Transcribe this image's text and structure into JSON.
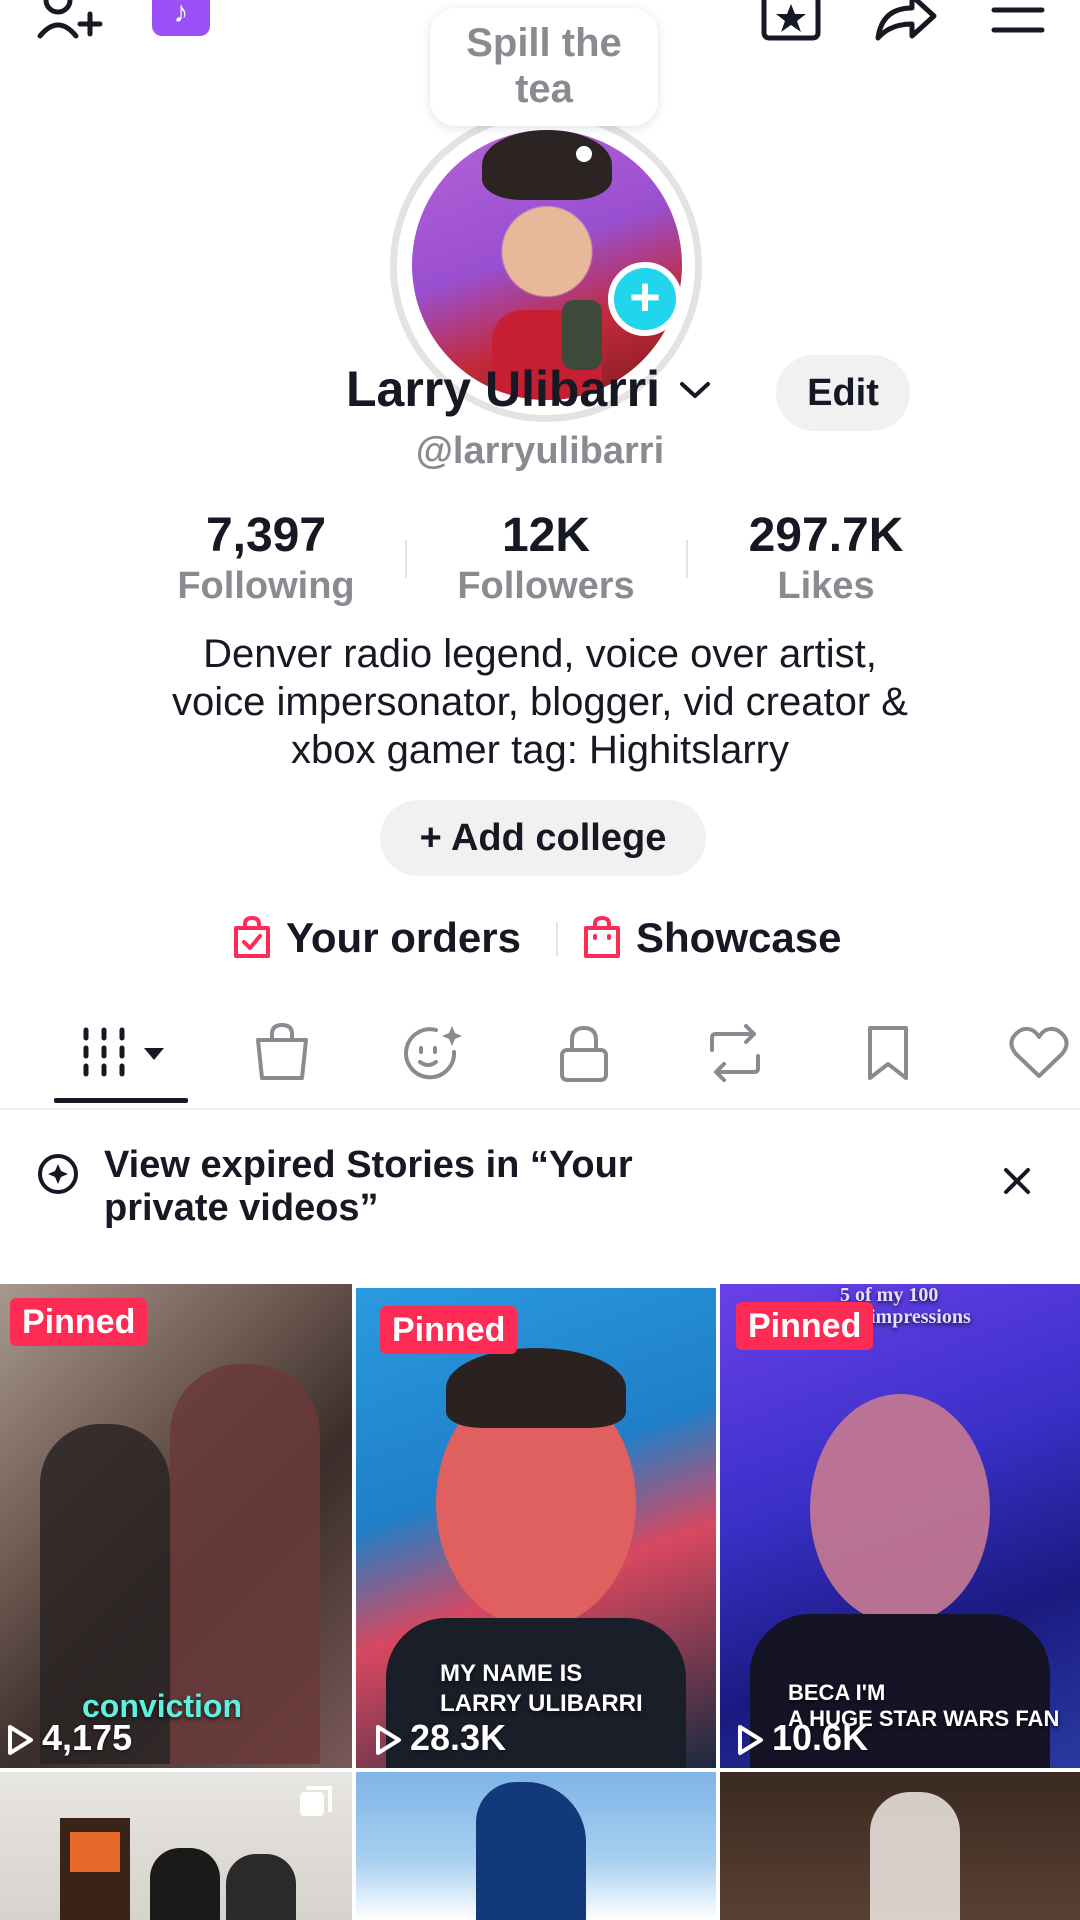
{
  "top_bar": {
    "icons": [
      "add-friend-icon",
      "tiktok-app-icon",
      "star-frame-icon",
      "share-icon",
      "menu-icon"
    ]
  },
  "profile": {
    "note_line1": "Spill the",
    "note_line2": "tea",
    "name": "Larry Ulibarri",
    "edit_label": "Edit",
    "handle": "@larryulibarri",
    "stats": [
      {
        "value": "7,397",
        "label": "Following"
      },
      {
        "value": "12K",
        "label": "Followers"
      },
      {
        "value": "297.7K",
        "label": "Likes"
      }
    ],
    "bio": [
      "Denver radio legend, voice over artist,",
      "voice impersonator, blogger, vid creator &",
      "xbox gamer tag: Highitslarry"
    ],
    "add_college_label": "+ Add college",
    "orders_label": "Your orders",
    "showcase_label": "Showcase"
  },
  "tabs": [
    "videos-tab",
    "shop-tab",
    "ai-self-tab",
    "private-tab",
    "reposts-tab",
    "favorites-tab",
    "liked-tab"
  ],
  "story_banner": {
    "text_line1": "View expired Stories in “Your",
    "text_line2": "private videos”"
  },
  "videos": [
    {
      "pinned": "Pinned",
      "views": "4,175",
      "caption": "conviction"
    },
    {
      "pinned": "Pinned",
      "views": "28.3K",
      "caption1": "MY NAME IS",
      "caption2": "LARRY ULIBARRI"
    },
    {
      "pinned": "Pinned",
      "views": "10.6K",
      "top_caption1": "5 of my 100",
      "top_caption2": "impressions",
      "caption1": "BECA    I'M",
      "caption2": "A HUGE STAR WARS FAN"
    }
  ],
  "colors": {
    "accent_red": "#fe2c55",
    "accent_cyan": "#20d5ec",
    "text_primary": "#161823",
    "text_secondary": "#8a8b91"
  }
}
